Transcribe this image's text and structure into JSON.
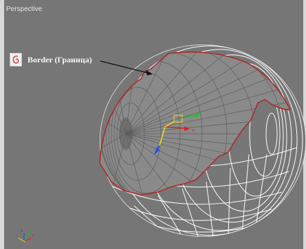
{
  "viewport": {
    "label": "Perspective",
    "background": "#767676"
  },
  "callout": {
    "label": "Border (Граница)",
    "icon": "border-icon",
    "icon_color": "#c0392b"
  },
  "object": {
    "wire_color_dense": "#5b5b5b",
    "wire_color_light": "#ffffff",
    "border_color": "#b02828"
  },
  "gizmo": {
    "x_label": "x",
    "y_label": "y",
    "z_label": "z"
  },
  "colors": {
    "axis_x": "#e02020",
    "axis_y": "#20c020",
    "axis_z": "#2a4ee0",
    "gizmo_yellow": "#f0e020"
  }
}
